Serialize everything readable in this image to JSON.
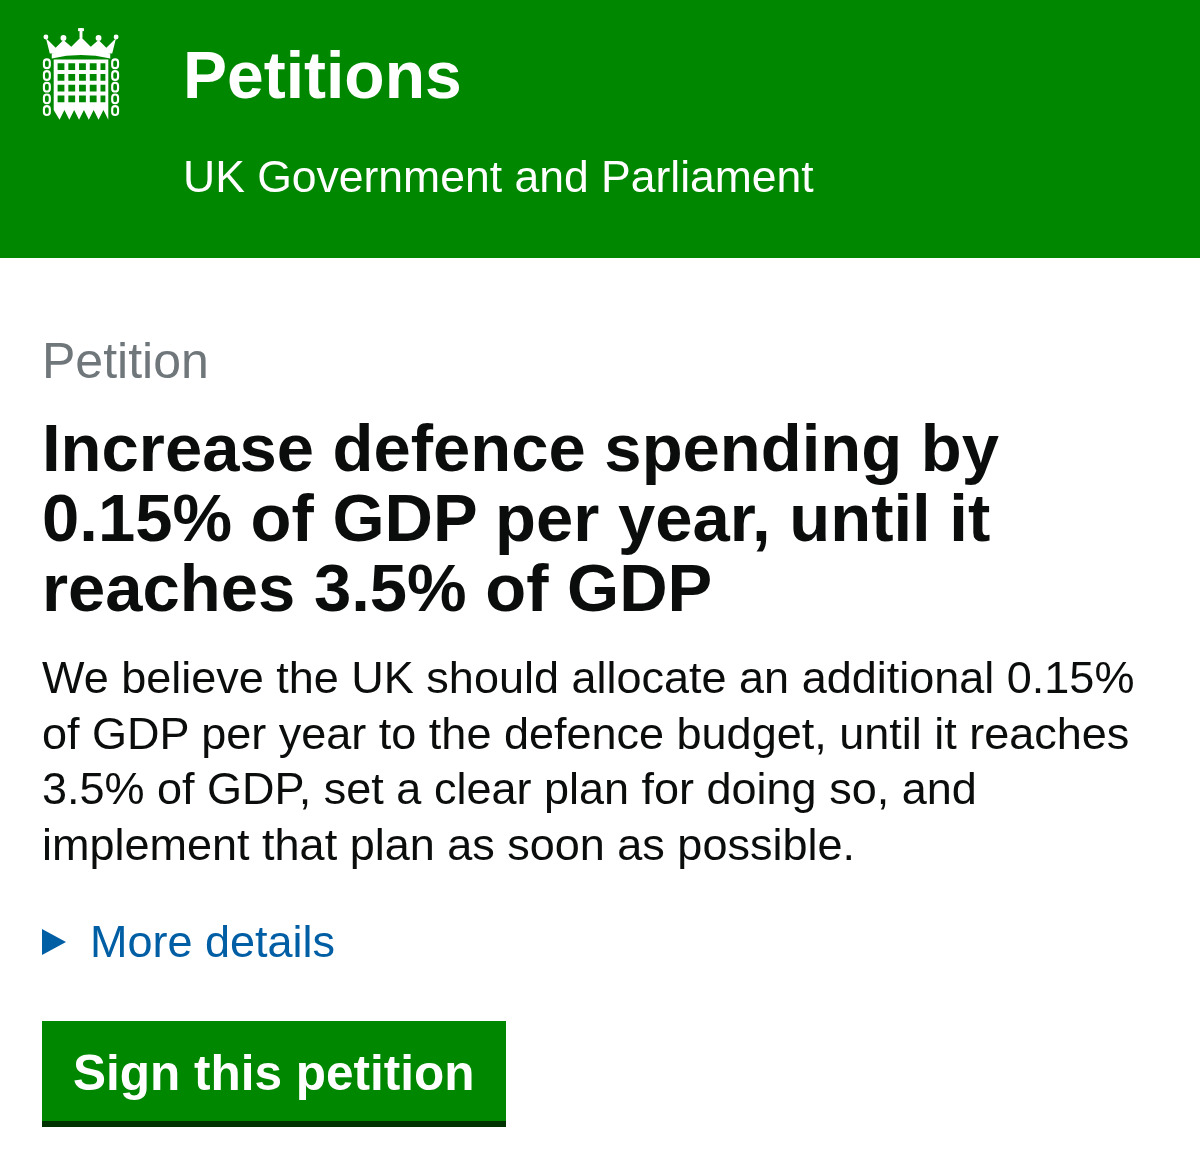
{
  "header": {
    "title": "Petitions",
    "subtitle": "UK Government and Parliament"
  },
  "petition": {
    "caption": "Petition",
    "heading": "Increase defence spending by 0.15% of GDP per year, until it reaches 3.5% of GDP",
    "description": "We believe the UK should allocate an additional 0.15% of GDP per year to the defence budget, until it reaches 3.5% of GDP, set a clear plan for doing so, and implement that plan as soon as possible."
  },
  "details": {
    "label": "More details",
    "expanded": false
  },
  "button": {
    "label": "Sign this petition"
  }
}
